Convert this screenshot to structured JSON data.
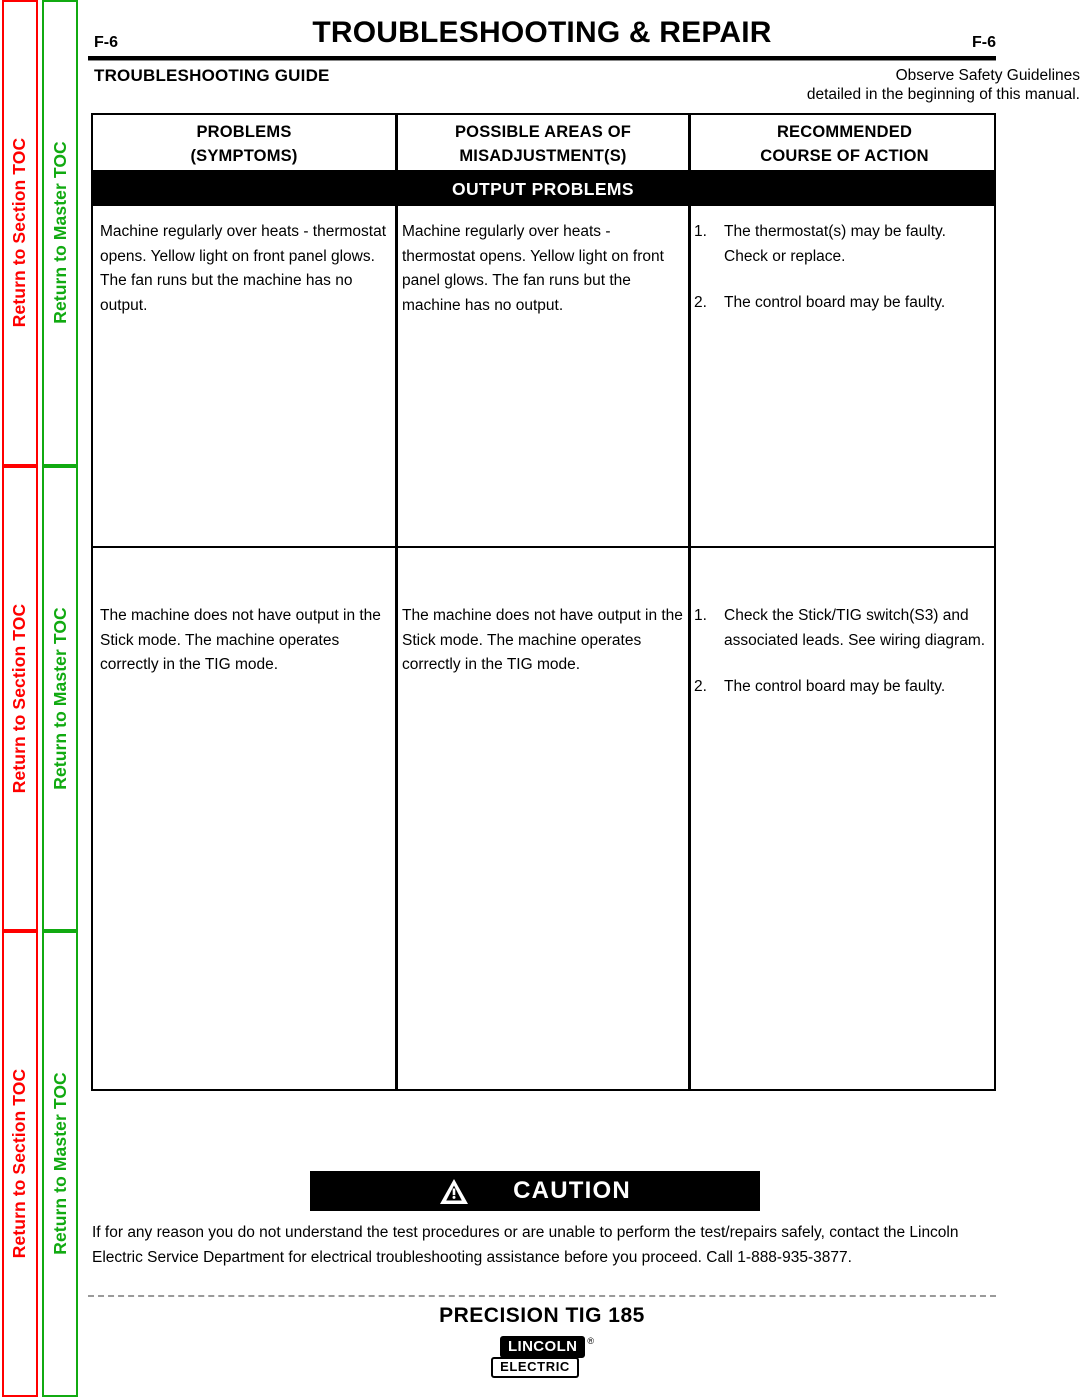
{
  "sidebar": {
    "section_toc_label": "Return to Section TOC",
    "master_toc_label": "Return to Master TOC",
    "section_toc_color": "#ff0000",
    "master_toc_color": "#11aa11",
    "repeat_count": 3
  },
  "header": {
    "page_number_left": "F-6",
    "page_number_right": "F-6",
    "title": "TROUBLESHOOTING & REPAIR",
    "guide_title": "TROUBLESHOOTING GUIDE",
    "safety_note_line1": "Observe Safety Guidelines",
    "safety_note_line2": "detailed in the beginning of this manual."
  },
  "table": {
    "columns": [
      {
        "line1": "PROBLEMS",
        "line2": "(SYMPTOMS)"
      },
      {
        "line1": "POSSIBLE AREAS OF",
        "line2": "MISADJUSTMENT(S)"
      },
      {
        "line1": "RECOMMENDED",
        "line2": "COURSE OF ACTION"
      }
    ],
    "section_band": "OUTPUT PROBLEMS",
    "rows": [
      {
        "symptoms": "Machine regularly over heats - thermostat opens.  Yellow light on front panel glows.  The fan runs but the machine has no output.",
        "misadjustments": "Machine regularly over heats - thermostat opens.  Yellow light on front panel glows.  The fan runs but the machine has no output.",
        "actions": [
          {
            "num": "1.",
            "text": "The thermostat(s) may be faulty. Check or replace."
          },
          {
            "num": "2.",
            "text": "The control board may be faulty."
          }
        ]
      },
      {
        "symptoms": "The machine does not have output in the Stick mode.  The machine operates correctly in the TIG mode.",
        "misadjustments": "The machine does not have output in the Stick mode.  The machine operates correctly in the TIG mode.",
        "actions": [
          {
            "num": "1.",
            "text": "Check the Stick/TIG switch(S3) and associated leads.  See wiring diagram."
          },
          {
            "num": "2.",
            "text": "The control board may be faulty."
          }
        ]
      }
    ]
  },
  "caution": {
    "label": "CAUTION",
    "icon": "warning-triangle-icon",
    "body": "If for any reason you do not understand the test procedures or are unable to perform the test/repairs safely, contact the Lincoln Electric Service Department for electrical troubleshooting assistance before you proceed.  Call 1-888-935-3877."
  },
  "footer": {
    "model": "PRECISION TIG 185",
    "logo_primary": "LINCOLN",
    "logo_registered": "®",
    "logo_secondary": "ELECTRIC"
  }
}
